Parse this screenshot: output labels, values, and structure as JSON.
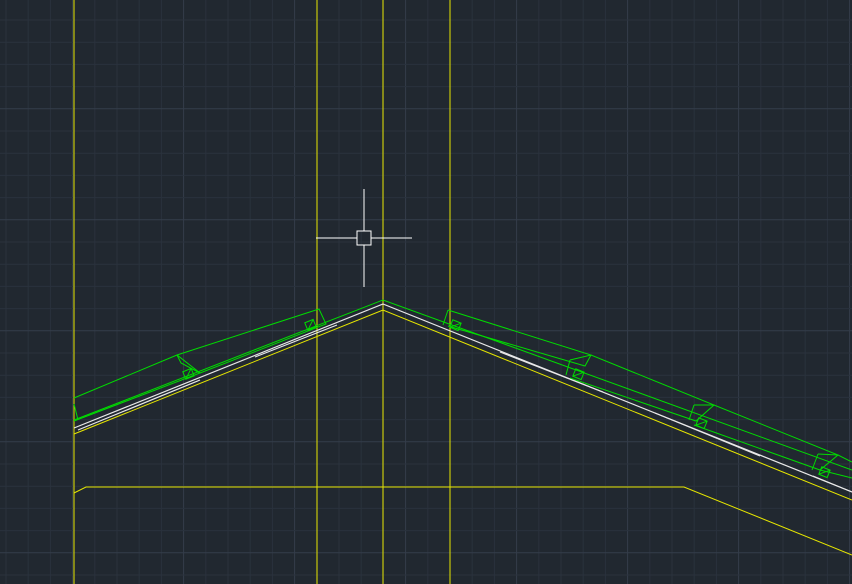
{
  "app": {
    "view": "cad-model-space"
  },
  "colors": {
    "background": "#212830",
    "grid_minor": "#2a323d",
    "grid_major": "#343d4a",
    "layer_yellow": "#e6e600",
    "layer_green": "#00dc00",
    "layer_white": "#e8e8e8",
    "crosshair": "#ffffff"
  },
  "icons": {
    "cursor": "crosshair-pickbox-icon"
  }
}
